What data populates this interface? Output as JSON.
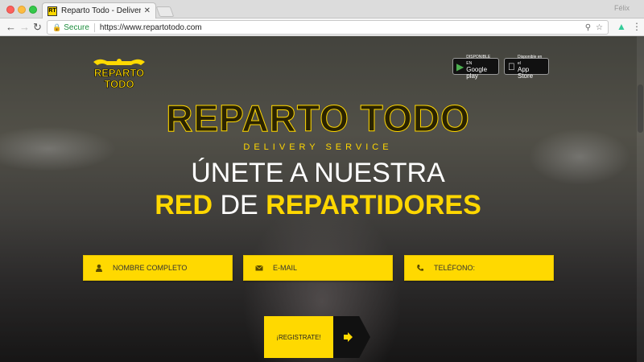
{
  "browser": {
    "tab_title": "Reparto Todo - Delivery Service",
    "tab_favicon": "RT",
    "tab_close": "✕",
    "secure_label": "Secure",
    "url": "https://www.repartotodo.com",
    "profile_text": "Félix"
  },
  "logo": {
    "line1": "REPARTO",
    "line2": "TODO"
  },
  "stores": {
    "google": {
      "small": "DISPONIBLE EN",
      "big": "Google play"
    },
    "apple": {
      "small": "Disponible en el",
      "big": "App Store"
    }
  },
  "hero": {
    "brand": "REPARTO TODO",
    "subtitle": "DELIVERY SERVICE",
    "headline_line1": "ÚNETE A NUESTRA",
    "headline_red": "RED",
    "headline_de": "DE",
    "headline_repartidores": "REPARTIDORES"
  },
  "form": {
    "name_placeholder": "NOMBRE COMPLETO",
    "email_placeholder": "E-MAIL",
    "phone_placeholder": "TELÉFONO:",
    "register_label": "¡REGISTRATE!"
  },
  "colors": {
    "accent": "#ffd900",
    "dark": "#111111"
  },
  "icons": {
    "name": "user-icon",
    "email": "envelope-icon",
    "phone": "phone-icon",
    "register": "sign-in-arrow-icon"
  }
}
